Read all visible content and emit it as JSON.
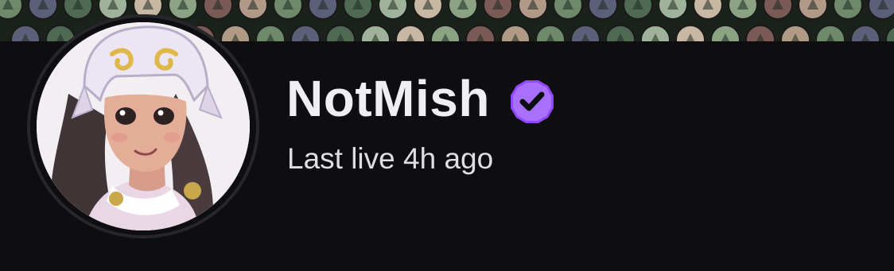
{
  "channel": {
    "name": "NotMish",
    "verified": true,
    "status_text": "Last live 4h ago"
  },
  "icons": {
    "verified_badge": "verified-checkmark-icon",
    "banner_pattern": "superhero-emblems-pattern"
  },
  "colors": {
    "background": "#0e0e10",
    "verified_badge": "#9147ff",
    "name_text": "#efeff1",
    "status_text": "#dedee3"
  }
}
